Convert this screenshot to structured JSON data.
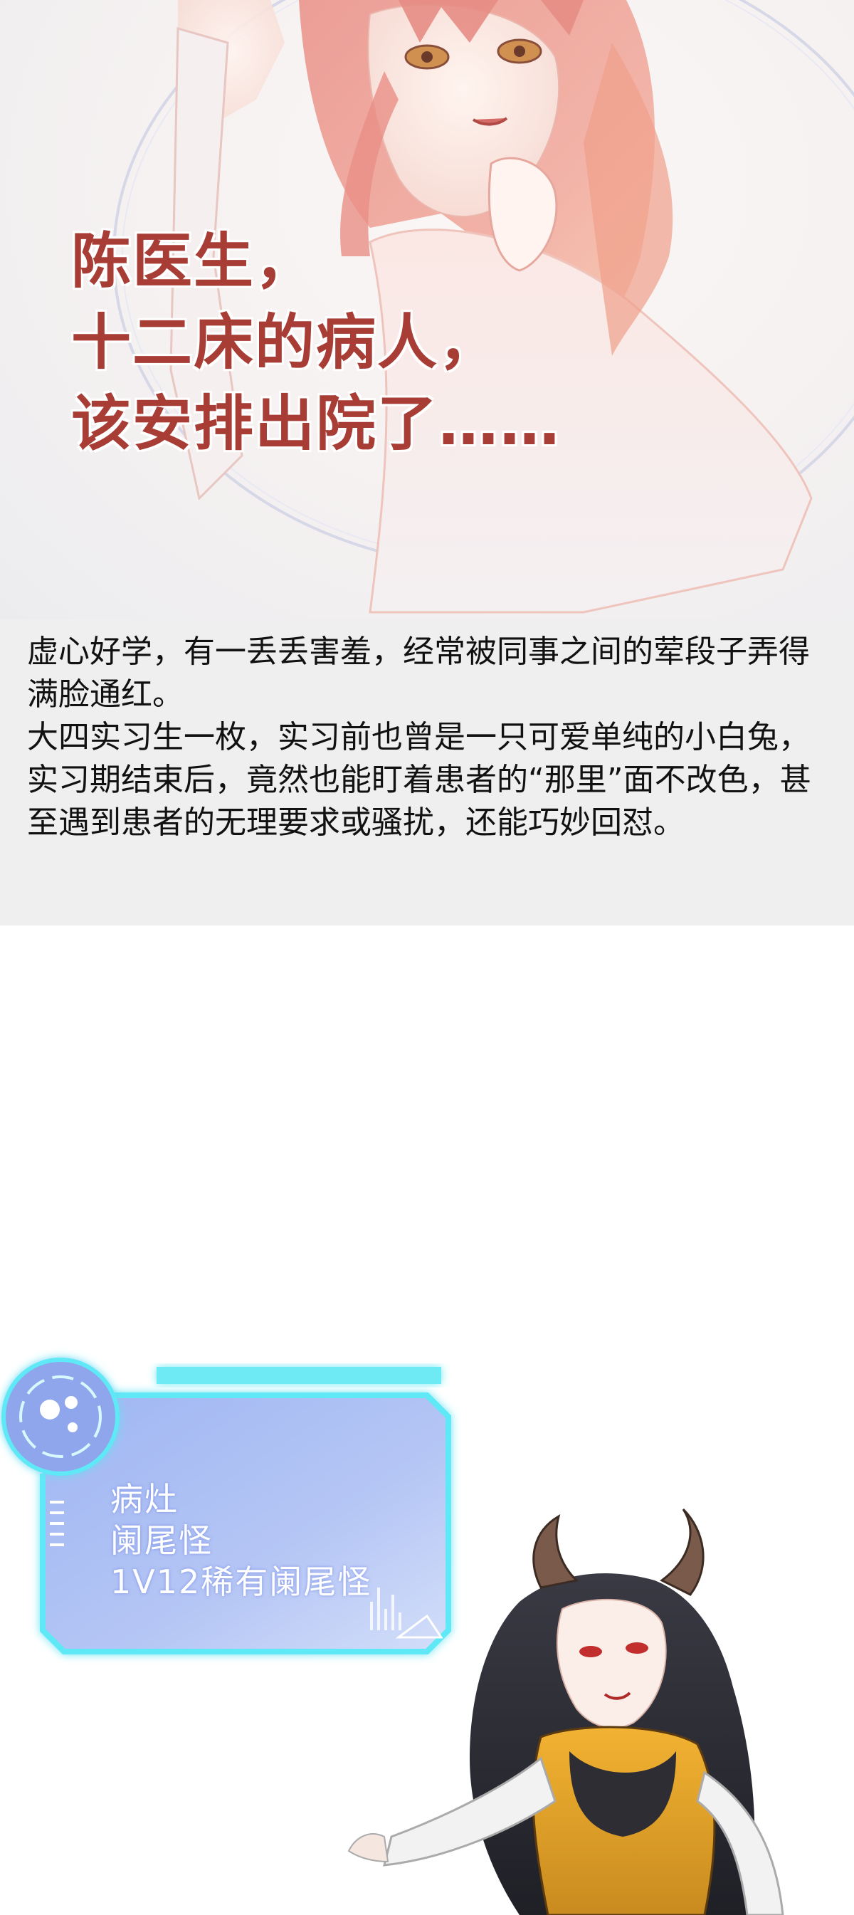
{
  "hero": {
    "quote_lines": [
      "陈医生，",
      "十二床的病人，",
      "该安排出院了……"
    ]
  },
  "description": {
    "text": "虚心好学，有一丢丢害羞，经常被同事之间的荤段子弄得满脸通红。\n大四实习生一枚，实习前也曾是一只可爱单纯的小白兔，实习期结束后，竟然也能盯着患者的“那里”面不改色，甚至遇到患者的无理要求或骚扰，还能巧妙回怼。"
  },
  "status_panel": {
    "lines": [
      "病灶",
      "阑尾怪",
      "1V12稀有阑尾怪"
    ]
  },
  "colors": {
    "quote_text": "#a83d35",
    "hud_glow": "#5ee8f5",
    "hud_fill": "#9fb6f2",
    "description_bg": "#efefef"
  }
}
